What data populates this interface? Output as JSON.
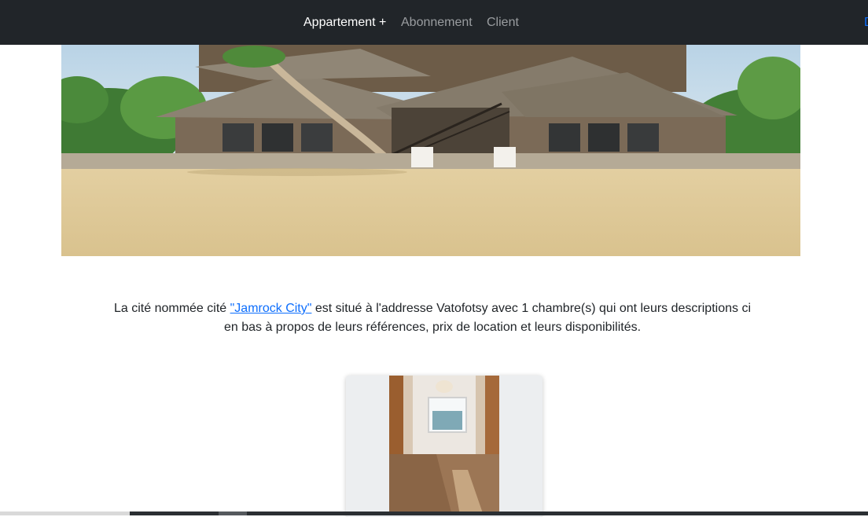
{
  "navbar": {
    "items": [
      {
        "label": "Appartement +",
        "active": true
      },
      {
        "label": "Abonnement",
        "active": false
      },
      {
        "label": "Client",
        "active": false
      }
    ],
    "edge_text": "D"
  },
  "hero": {
    "icon": "beach-house-photo"
  },
  "description": {
    "before": "La cité nommée cité ",
    "link": "\"Jamrock City\"",
    "after": " est situé à l'addresse Vatofotsy avec 1 chambre(s) qui ont leurs descriptions ci en bas à propos de leurs références, prix de location et leurs disponibilités."
  },
  "room_card": {
    "icon": "room-photo"
  },
  "colors": {
    "navbar": "#212529",
    "link": "#0d6efd",
    "active_nav": "#ffffff",
    "inactive_nav": "#9a9da0"
  }
}
